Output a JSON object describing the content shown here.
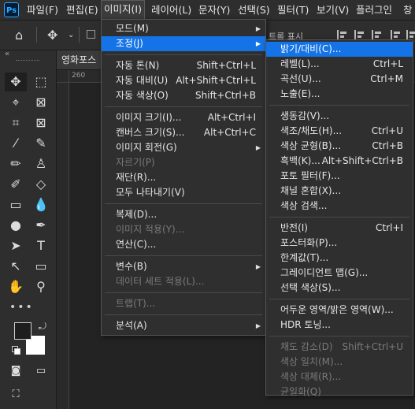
{
  "app": {
    "logo_text": "Ps"
  },
  "menubar": {
    "items": [
      {
        "label": "파일(F)"
      },
      {
        "label": "편집(E)"
      },
      {
        "label": "이미지(I)",
        "active": true
      },
      {
        "label": "레이어(L)"
      },
      {
        "label": "문자(Y)"
      },
      {
        "label": "선택(S)"
      },
      {
        "label": "필터(T)"
      },
      {
        "label": "보기(V)"
      },
      {
        "label": "플러그인"
      },
      {
        "label": "창"
      }
    ]
  },
  "options_bar": {
    "partial_label": "트롤 표시"
  },
  "tools": {
    "collapse_label": "«"
  },
  "document": {
    "tab_title": "영화포스",
    "ruler_label": "260"
  },
  "image_menu": {
    "groups": [
      [
        {
          "label": "모드(M)",
          "submenu": true
        },
        {
          "label": "조정(J)",
          "submenu": true,
          "highlight": true
        }
      ],
      [
        {
          "label": "자동 톤(N)",
          "shortcut": "Shift+Ctrl+L"
        },
        {
          "label": "자동 대비(U)",
          "shortcut": "Alt+Shift+Ctrl+L"
        },
        {
          "label": "자동 색상(O)",
          "shortcut": "Shift+Ctrl+B"
        }
      ],
      [
        {
          "label": "이미지 크기(I)...",
          "shortcut": "Alt+Ctrl+I"
        },
        {
          "label": "캔버스 크기(S)...",
          "shortcut": "Alt+Ctrl+C"
        },
        {
          "label": "이미지 회전(G)",
          "submenu": true
        },
        {
          "label": "자르기(P)",
          "disabled": true
        },
        {
          "label": "재단(R)..."
        },
        {
          "label": "모두 나타내기(V)"
        }
      ],
      [
        {
          "label": "복제(D)..."
        },
        {
          "label": "이미지 적용(Y)...",
          "disabled": true
        },
        {
          "label": "연산(C)..."
        }
      ],
      [
        {
          "label": "변수(B)",
          "submenu": true
        },
        {
          "label": "데이터 세트 적용(L)...",
          "disabled": true
        }
      ],
      [
        {
          "label": "트랩(T)...",
          "disabled": true
        }
      ],
      [
        {
          "label": "분석(A)",
          "submenu": true
        }
      ]
    ]
  },
  "adjustments_menu": {
    "groups": [
      [
        {
          "label": "밝기/대비(C)...",
          "highlight": true
        },
        {
          "label": "레벨(L)...",
          "shortcut": "Ctrl+L"
        },
        {
          "label": "곡선(U)...",
          "shortcut": "Ctrl+M"
        },
        {
          "label": "노출(E)..."
        }
      ],
      [
        {
          "label": "생동감(V)..."
        },
        {
          "label": "색조/채도(H)...",
          "shortcut": "Ctrl+U"
        },
        {
          "label": "색상 균형(B)...",
          "shortcut": "Ctrl+B"
        },
        {
          "label": "흑백(K)...",
          "shortcut": "Alt+Shift+Ctrl+B"
        },
        {
          "label": "포토 필터(F)..."
        },
        {
          "label": "채널 혼합(X)..."
        },
        {
          "label": "색상 검색..."
        }
      ],
      [
        {
          "label": "반전(I)",
          "shortcut": "Ctrl+I"
        },
        {
          "label": "포스터화(P)..."
        },
        {
          "label": "한계값(T)..."
        },
        {
          "label": "그레이디언트 맵(G)..."
        },
        {
          "label": "선택 색상(S)..."
        }
      ],
      [
        {
          "label": "어두운 영역/밝은 영역(W)..."
        },
        {
          "label": "HDR 토닝..."
        }
      ],
      [
        {
          "label": "채도 감소(D)",
          "shortcut": "Shift+Ctrl+U",
          "disabled": true
        },
        {
          "label": "색상 일치(M)...",
          "disabled": true
        },
        {
          "label": "색상 대체(R)...",
          "disabled": true
        },
        {
          "label": "균일화(Q)",
          "disabled": true
        }
      ]
    ]
  }
}
